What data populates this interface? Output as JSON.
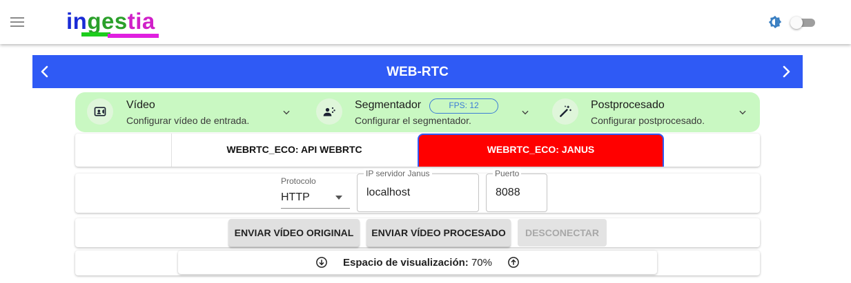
{
  "header": {
    "logo": {
      "part1": "in",
      "part2": "ges",
      "part3": "tia"
    },
    "menu_icon": "menu-icon",
    "theme_icon": "brightness-icon",
    "theme_toggle_on": false
  },
  "banner": {
    "title": "WEB-RTC",
    "prev_icon": "chevron-left-icon",
    "next_icon": "chevron-right-icon"
  },
  "steps": [
    {
      "name": "Vídeo",
      "desc": "Configurar vídeo de entrada.",
      "icon": "video-camera-icon"
    },
    {
      "name": "Segmentador",
      "desc": "Configurar el segmentador.",
      "icon": "segmentation-icon",
      "badge": "FPS: 12"
    },
    {
      "name": "Postprocesado",
      "desc": "Configurar postprocesado.",
      "icon": "magic-wand-icon"
    }
  ],
  "tabs": [
    {
      "label": "WEBRTC_ECO: API WEBRTC",
      "active": false
    },
    {
      "label": "WEBRTC_ECO: JANUS",
      "active": true
    }
  ],
  "form": {
    "protocol": {
      "label": "Protocolo",
      "value": "HTTP"
    },
    "server": {
      "label": "IP servidor Janus",
      "value": "localhost"
    },
    "port": {
      "label": "Puerto",
      "value": "8088"
    }
  },
  "actions": {
    "send_original": "ENVIAR VÍDEO ORIGINAL",
    "send_processed": "ENVIAR VÍDEO PROCESADO",
    "disconnect": "DESCONECTAR"
  },
  "display": {
    "label": "Espacio de visualización:",
    "value": "70%"
  },
  "colors": {
    "accent": "#2f5af5",
    "steps_bg": "#c9f8c2",
    "active_tab": "#ff0000",
    "fps_badge": "#3a7bd6"
  }
}
